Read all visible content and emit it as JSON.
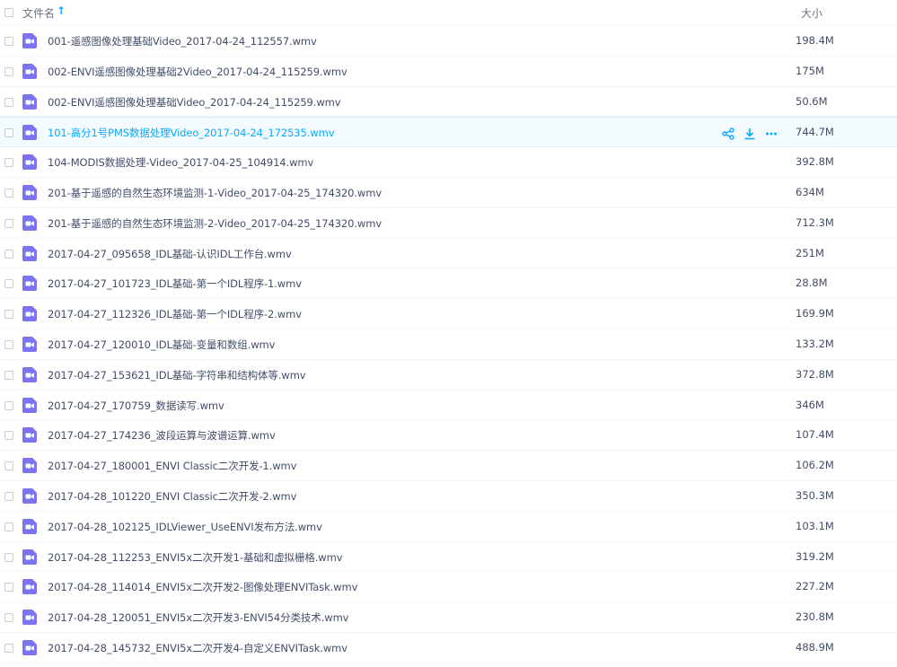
{
  "header": {
    "name_label": "文件名",
    "sort_icon": "arrow-up-icon",
    "size_label": "大小"
  },
  "colors": {
    "accent": "#09aaff",
    "icon_purple": "#7b73f0",
    "text": "#424e67"
  },
  "files": [
    {
      "name": "001-遥感图像处理基础Video_2017-04-24_112557.wmv",
      "size": "198.4M"
    },
    {
      "name": "002-ENVI遥感图像处理基础2Video_2017-04-24_115259.wmv",
      "size": "175M"
    },
    {
      "name": "002-ENVI遥感图像处理基础Video_2017-04-24_115259.wmv",
      "size": "50.6M"
    },
    {
      "name": "101-高分1号PMS数据处理Video_2017-04-24_172535.wmv",
      "size": "744.7M"
    },
    {
      "name": "104-MODIS数据处理-Video_2017-04-25_104914.wmv",
      "size": "392.8M"
    },
    {
      "name": "201-基于遥感的自然生态环境监测-1-Video_2017-04-25_174320.wmv",
      "size": "634M"
    },
    {
      "name": "201-基于遥感的自然生态环境监测-2-Video_2017-04-25_174320.wmv",
      "size": "712.3M"
    },
    {
      "name": "2017-04-27_095658_IDL基础-认识IDL工作台.wmv",
      "size": "251M"
    },
    {
      "name": "2017-04-27_101723_IDL基础-第一个IDL程序-1.wmv",
      "size": "28.8M"
    },
    {
      "name": "2017-04-27_112326_IDL基础-第一个IDL程序-2.wmv",
      "size": "169.9M"
    },
    {
      "name": "2017-04-27_120010_IDL基础-变量和数组.wmv",
      "size": "133.2M"
    },
    {
      "name": "2017-04-27_153621_IDL基础-字符串和结构体等.wmv",
      "size": "372.8M"
    },
    {
      "name": "2017-04-27_170759_数据读写.wmv",
      "size": "346M"
    },
    {
      "name": "2017-04-27_174236_波段运算与波谱运算.wmv",
      "size": "107.4M"
    },
    {
      "name": "2017-04-27_180001_ENVI Classic二次开发-1.wmv",
      "size": "106.2M"
    },
    {
      "name": "2017-04-28_101220_ENVI Classic二次开发-2.wmv",
      "size": "350.3M"
    },
    {
      "name": "2017-04-28_102125_IDLViewer_UseENVI发布方法.wmv",
      "size": "103.1M"
    },
    {
      "name": "2017-04-28_112253_ENVI5x二次开发1-基础和虚拟栅格.wmv",
      "size": "319.2M"
    },
    {
      "name": "2017-04-28_114014_ENVI5x二次开发2-图像处理ENVITask.wmv",
      "size": "227.2M"
    },
    {
      "name": "2017-04-28_120051_ENVI5x二次开发3-ENVI54分类技术.wmv",
      "size": "230.8M"
    },
    {
      "name": "2017-04-28_145732_ENVI5x二次开发4-自定义ENVITask.wmv",
      "size": "488.9M"
    }
  ],
  "hover_row": 3,
  "hover_actions": [
    {
      "icon": "share-icon"
    },
    {
      "icon": "download-icon"
    },
    {
      "icon": "more-icon"
    }
  ]
}
